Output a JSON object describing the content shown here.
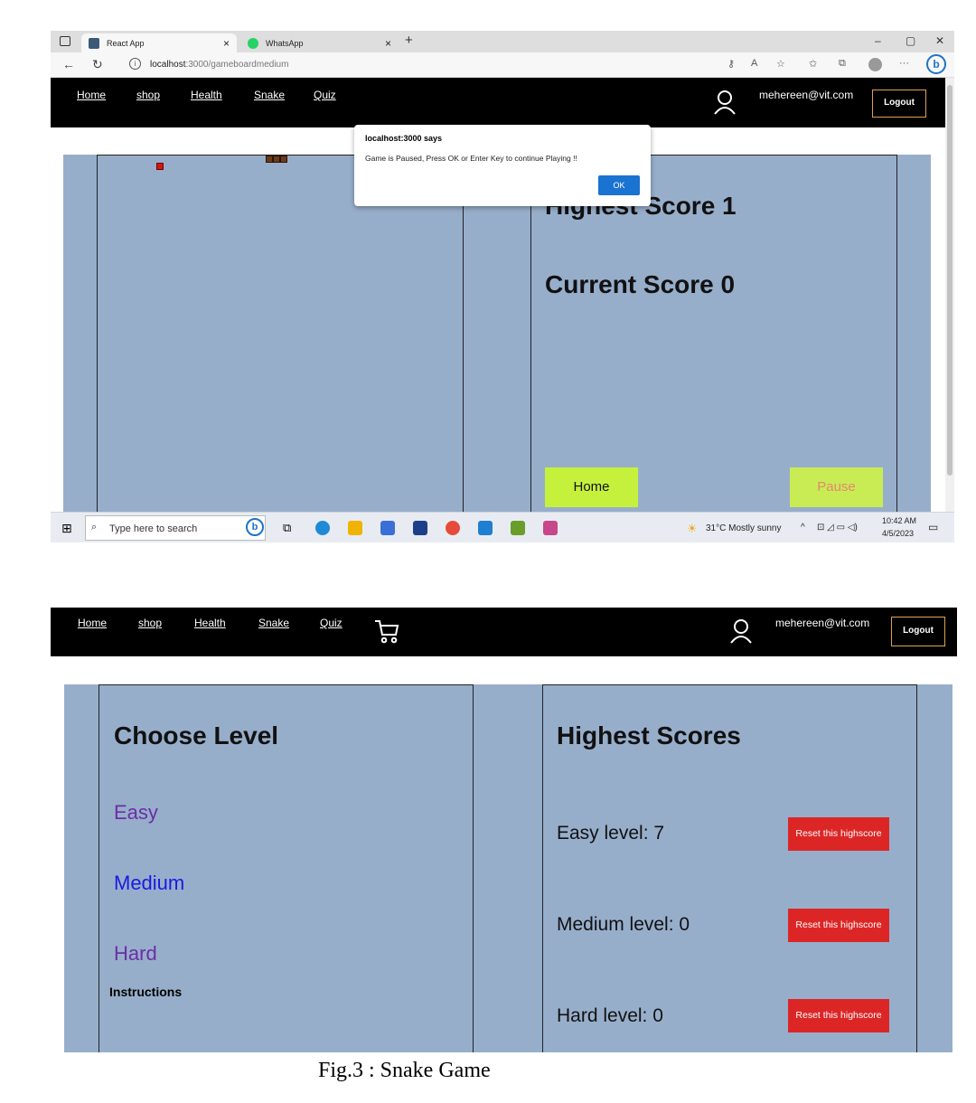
{
  "browser": {
    "tabs": [
      {
        "title": "React App",
        "favicon": "react-favicon",
        "active": true
      },
      {
        "title": "WhatsApp",
        "favicon": "whatsapp-favicon",
        "active": false
      }
    ],
    "url_host": "localhost",
    "url_path": ":3000/gameboardmedium"
  },
  "nav": {
    "links": [
      "Home",
      "shop",
      "Health",
      "Snake",
      "Quiz"
    ],
    "email": "mehereen@vit.com",
    "logout_label": "Logout"
  },
  "dialog": {
    "title": "localhost:3000 says",
    "message": "Game is Paused, Press OK or Enter Key to continue Playing !!",
    "ok_label": "OK"
  },
  "game": {
    "highest_score_label": "Highest Score 1",
    "current_score_label": "Current Score 0",
    "home_button": "Home",
    "pause_button": "Pause"
  },
  "taskbar": {
    "search_placeholder": "Type here to search",
    "weather": "31°C  Mostly sunny",
    "time": "10:42 AM",
    "date": "4/5/2023"
  },
  "levels": {
    "heading": "Choose Level",
    "options": [
      "Easy",
      "Medium",
      "Hard"
    ],
    "instructions_label": "Instructions"
  },
  "highscores": {
    "heading": "Highest Scores",
    "rows": [
      {
        "label": "Easy level: 7",
        "button": "Reset this highscore"
      },
      {
        "label": "Medium level: 0",
        "button": "Reset this highscore"
      },
      {
        "label": "Hard level: 0",
        "button": "Reset this highscore"
      }
    ]
  },
  "caption": "Fig.3 : Snake Game",
  "colors": {
    "board_bg": "#97aecb",
    "navbar_bg": "#000000",
    "button_green": "#c5f13d",
    "reset_red": "#dc2626",
    "link_visited": "#6a2ea8",
    "link_blue": "#1a1ae0",
    "dialog_ok": "#1a73d0"
  }
}
